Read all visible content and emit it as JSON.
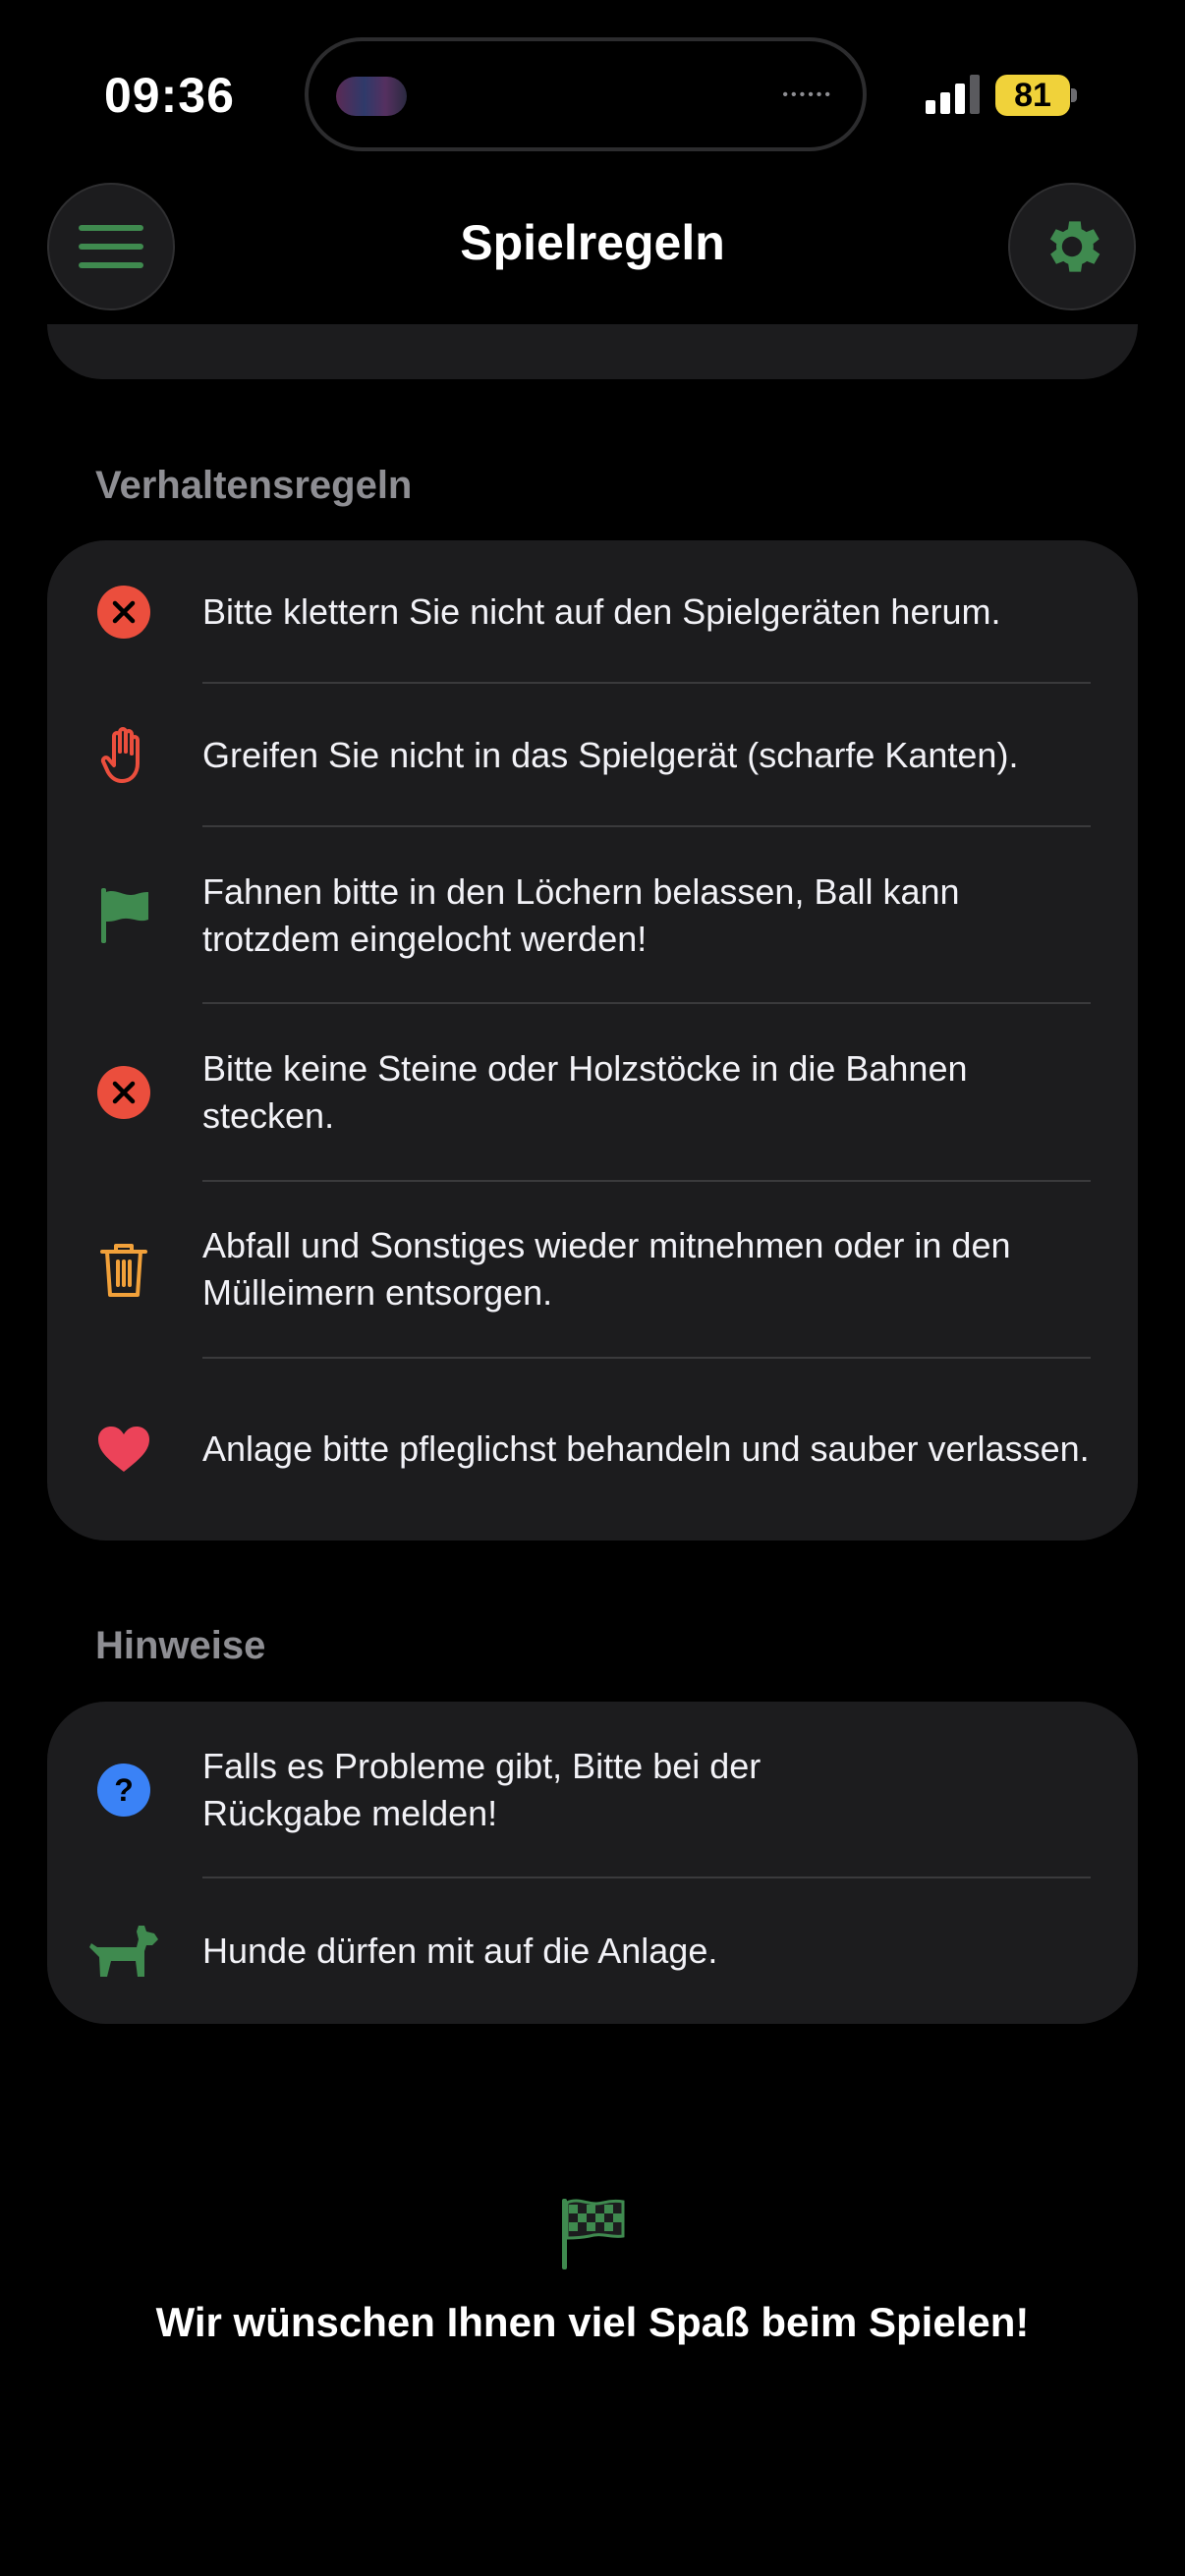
{
  "status_bar": {
    "time": "09:36",
    "battery": "81"
  },
  "nav": {
    "title": "Spielregeln",
    "menu_icon": "menu-icon",
    "settings_icon": "gear-icon"
  },
  "sections": {
    "behavior": {
      "title": "Verhaltensregeln",
      "items": [
        {
          "icon": "x-circle-icon",
          "color": "#eb4e3d",
          "text": "Bitte klettern Sie nicht auf den Spielgeräten herum."
        },
        {
          "icon": "hand-icon",
          "color": "#eb4e3d",
          "text": "Greifen Sie nicht in das Spielgerät (scharfe Kanten)."
        },
        {
          "icon": "flag-icon",
          "color": "#3f8a4f",
          "text": "Fahnen bitte in den Löchern belassen, Ball kann trotzdem eingelocht werden!"
        },
        {
          "icon": "x-circle-icon",
          "color": "#eb4e3d",
          "text": "Bitte keine Steine oder Holzstöcke in die Bahnen stecken."
        },
        {
          "icon": "trash-icon",
          "color": "#f2a13a",
          "text": "Abfall und Sonstiges wieder mitnehmen oder in den Mülleimern entsorgen."
        },
        {
          "icon": "heart-icon",
          "color": "#ec4359",
          "text": "Anlage bitte pfleglichst behandeln und sauber verlassen."
        }
      ]
    },
    "hints": {
      "title": "Hinweise",
      "items": [
        {
          "icon": "question-circle-icon",
          "color": "#3a82f6",
          "text": "Falls es Probleme gibt, Bitte bei der Rückgabe melden!"
        },
        {
          "icon": "dog-icon",
          "color": "#3f8a4f",
          "text": "Hunde dürfen mit auf die Anlage."
        }
      ]
    }
  },
  "footer": {
    "icon": "checkered-flag-icon",
    "text": "Wir wünschen Ihnen viel Spaß beim Spielen!"
  },
  "colors": {
    "accent_green": "#3f8a4f",
    "card_bg": "#1c1c1e",
    "background": "#000000"
  }
}
